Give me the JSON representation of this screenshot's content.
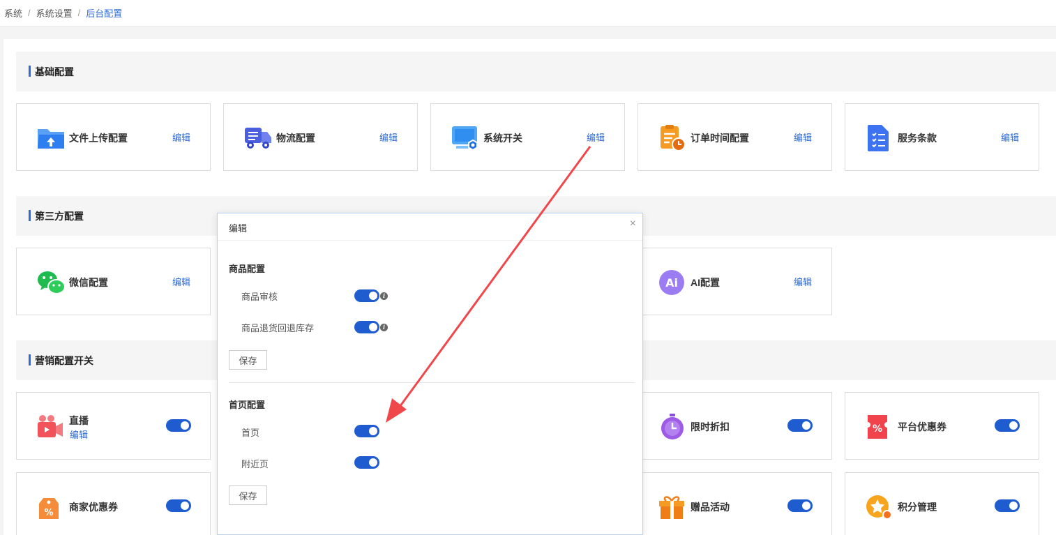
{
  "breadcrumb": [
    "系统",
    "系统设置",
    "后台配置"
  ],
  "sections": {
    "basic": "基础配置",
    "third_party": "第三方配置",
    "marketing": "营销配置开关"
  },
  "edit_label": "编辑",
  "basic_cards": [
    {
      "label": "文件上传配置",
      "icon": "folder-upload-icon"
    },
    {
      "label": "物流配置",
      "icon": "truck-icon"
    },
    {
      "label": "系统开关",
      "icon": "monitor-settings-icon"
    },
    {
      "label": "订单时间配置",
      "icon": "clipboard-clock-icon"
    },
    {
      "label": "服务条款",
      "icon": "document-list-icon"
    }
  ],
  "third_party_cards": [
    {
      "label": "微信配置",
      "icon": "wechat-icon"
    },
    {
      "label": "AI配置",
      "icon": "ai-icon"
    }
  ],
  "marketing_cards": [
    {
      "label": "直播",
      "sub": "编辑",
      "icon": "live-camera-icon",
      "on": true
    },
    {
      "label": "限时折扣",
      "icon": "stopwatch-icon",
      "on": true
    },
    {
      "label": "平台优惠券",
      "icon": "coupon-icon",
      "on": true
    },
    {
      "label": "商家优惠券",
      "icon": "tag-percent-icon",
      "on": true
    },
    {
      "label": "赠品活动",
      "icon": "gift-icon",
      "on": true
    },
    {
      "label": "积分管理",
      "icon": "points-star-icon",
      "on": true
    }
  ],
  "modal": {
    "title": "编辑",
    "close": "×",
    "groups": [
      {
        "title": "商品配置",
        "rows": [
          {
            "label": "商品审核",
            "on": true
          },
          {
            "label": "商品退货回退库存",
            "on": true
          }
        ],
        "save": "保存"
      },
      {
        "title": "首页配置",
        "rows": [
          {
            "label": "首页",
            "on": true
          },
          {
            "label": "附近页",
            "on": true
          }
        ],
        "save": "保存"
      }
    ]
  },
  "colors": {
    "accent": "#2d6bd6",
    "toggle": "#1f5cd0",
    "arrow": "#f0474b"
  }
}
